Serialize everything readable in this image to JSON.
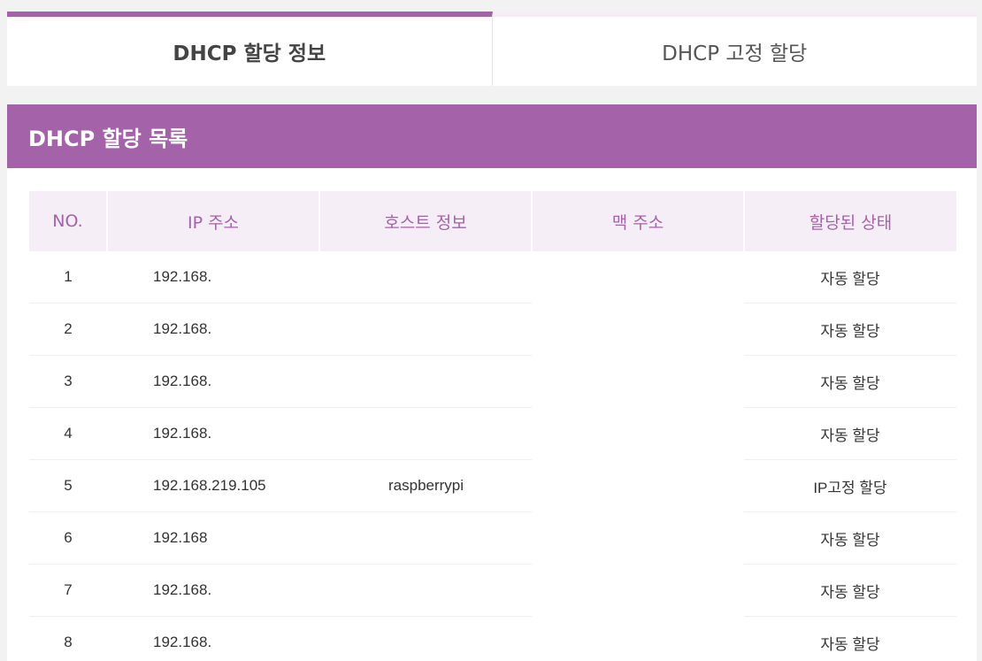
{
  "tabs": [
    {
      "label": "DHCP 할당 정보",
      "active": true
    },
    {
      "label": "DHCP 고정 할당",
      "active": false
    }
  ],
  "panel": {
    "title": "DHCP 할당 목록"
  },
  "table": {
    "headers": [
      "NO.",
      "IP 주소",
      "호스트 정보",
      "맥 주소",
      "할당된 상태"
    ],
    "rows": [
      {
        "no": "1",
        "ip": "192.168.",
        "host": "",
        "mac": "",
        "state": "자동 할당"
      },
      {
        "no": "2",
        "ip": "192.168.",
        "host": "",
        "mac": "",
        "state": "자동 할당"
      },
      {
        "no": "3",
        "ip": "192.168.",
        "host": "",
        "mac": "",
        "state": "자동 할당"
      },
      {
        "no": "4",
        "ip": "192.168.",
        "host": "",
        "mac": "",
        "state": "자동 할당"
      },
      {
        "no": "5",
        "ip": "192.168.219.105",
        "host": "raspberrypi",
        "mac": "",
        "state": "IP고정 할당"
      },
      {
        "no": "6",
        "ip": " 192.168",
        "host": "",
        "mac": "",
        "state": "자동 할당"
      },
      {
        "no": "7",
        "ip": "192.168.",
        "host": "",
        "mac": "",
        "state": "자동 할당"
      },
      {
        "no": "8",
        "ip": "192.168.",
        "host": "",
        "mac": "",
        "state": "자동 할당"
      }
    ]
  },
  "colors": {
    "accent": "#a463a8",
    "header_bg": "#f6eef7"
  }
}
